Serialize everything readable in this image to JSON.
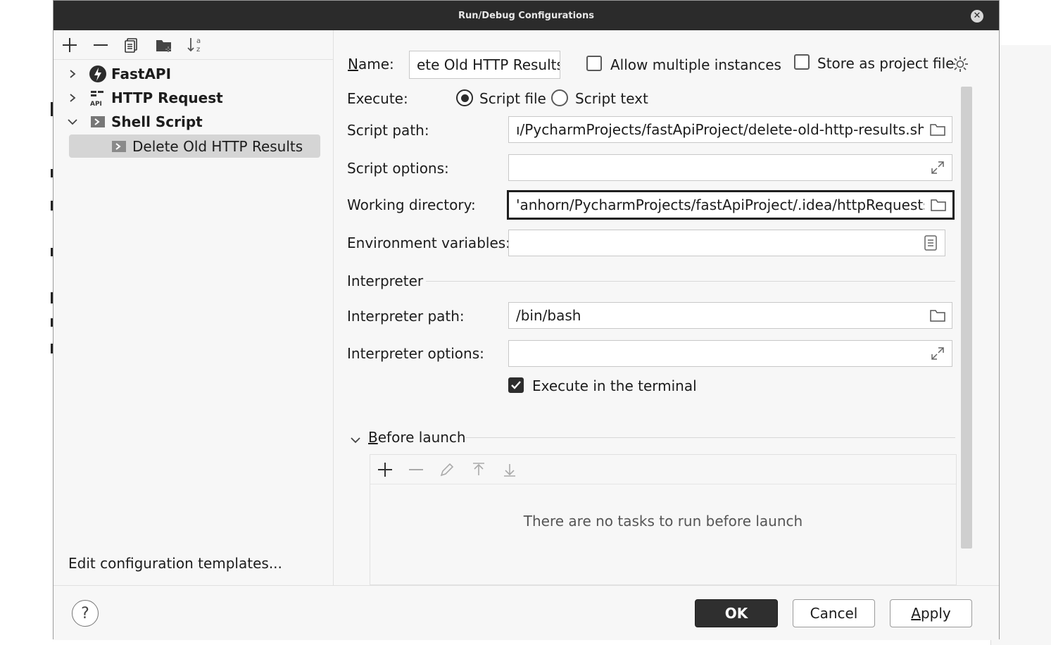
{
  "window": {
    "title": "Run/Debug Configurations"
  },
  "tree": {
    "items": [
      {
        "label": "FastAPI",
        "icon": "fastapi-icon",
        "expanded": false
      },
      {
        "label": "HTTP Request",
        "icon": "api-icon",
        "expanded": false
      },
      {
        "label": "Shell Script",
        "icon": "shell-script-icon",
        "expanded": true
      }
    ],
    "selected_child": "Delete Old HTTP Results",
    "edit_templates": "Edit configuration templates..."
  },
  "form": {
    "name_label": "Name:",
    "name_value": "ete Old HTTP Results",
    "allow_multiple": "Allow multiple instances",
    "store_project": "Store as project file",
    "execute_label": "Execute:",
    "script_file": "Script file",
    "script_text": "Script text",
    "script_path_label": "Script path:",
    "script_path_value": "ı/PycharmProjects/fastApiProject/delete-old-http-results.sh",
    "script_options_label": "Script options:",
    "script_options_value": "",
    "working_dir_label": "Working directory:",
    "working_dir_value": "'anhorn/PycharmProjects/fastApiProject/.idea/httpRequests",
    "env_vars_label": "Environment variables:",
    "env_vars_value": "",
    "interpreter_section": "Interpreter",
    "interp_path_label": "Interpreter path:",
    "interp_path_value": "/bin/bash",
    "interp_options_label": "Interpreter options:",
    "interp_options_value": "",
    "execute_terminal": "Execute in the terminal",
    "before_launch": "Before launch",
    "no_tasks": "There are no tasks to run before launch"
  },
  "footer": {
    "help": "?",
    "ok": "OK",
    "cancel": "Cancel",
    "apply": "Apply"
  }
}
